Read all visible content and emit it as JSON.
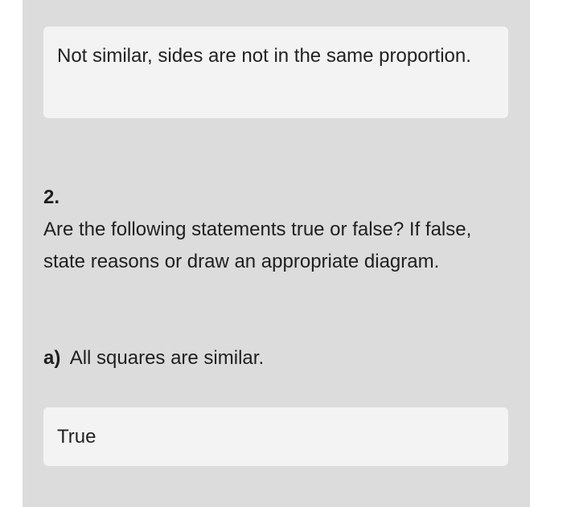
{
  "answers": {
    "previous": "Not similar, sides are not in the same proportion.",
    "part_a": "True"
  },
  "question": {
    "number": "2.",
    "text": "Are the following statements true or false? If false, state reasons or draw an appropriate diagram.",
    "part_a": {
      "label": "a)",
      "text": "All squares are similar."
    }
  }
}
